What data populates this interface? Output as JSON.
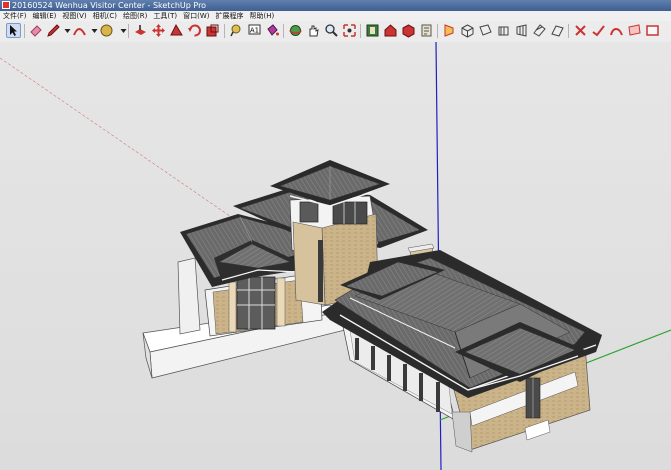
{
  "window": {
    "title": "20160524 Wenhua Visitor Center - SketchUp Pro"
  },
  "menu": [
    "文件(F)",
    "编辑(E)",
    "视图(V)",
    "相机(C)",
    "绘图(R)",
    "工具(T)",
    "窗口(W)",
    "扩展程序",
    "帮助(H)"
  ],
  "toolbar": {
    "tools": [
      "select-icon",
      "eraser-icon",
      "pencil-icon",
      "dropdown-icon",
      "arc-icon",
      "dropdown-icon",
      "rotate-icon",
      "dropdown-icon",
      "push-pull-icon",
      "move-icon",
      "follow-me-icon",
      "rotate-tool-icon",
      "scale-icon",
      "tape-measure-icon",
      "text-icon",
      "paint-bucket-icon",
      "orbit-icon",
      "pan-icon",
      "zoom-icon",
      "zoom-extents-icon",
      "component-icon",
      "warehouse-icon",
      "extension-icon",
      "style-icon",
      "section-plane-icon",
      "iso-view-icon",
      "top-view-icon",
      "front-view-icon",
      "right-view-icon",
      "back-view-icon",
      "left-view-icon",
      "xray-icon",
      "hidden-line-icon",
      "shaded-icon",
      "texture-icon",
      "monochrome-icon"
    ]
  },
  "colors": {
    "roof": "#4d4d4d",
    "eave": "#2b2b2b",
    "wall": "#c9b186",
    "trim": "#f4f4f4",
    "axis_red": "#c03030",
    "axis_green": "#30a030",
    "axis_blue": "#2020c0"
  }
}
